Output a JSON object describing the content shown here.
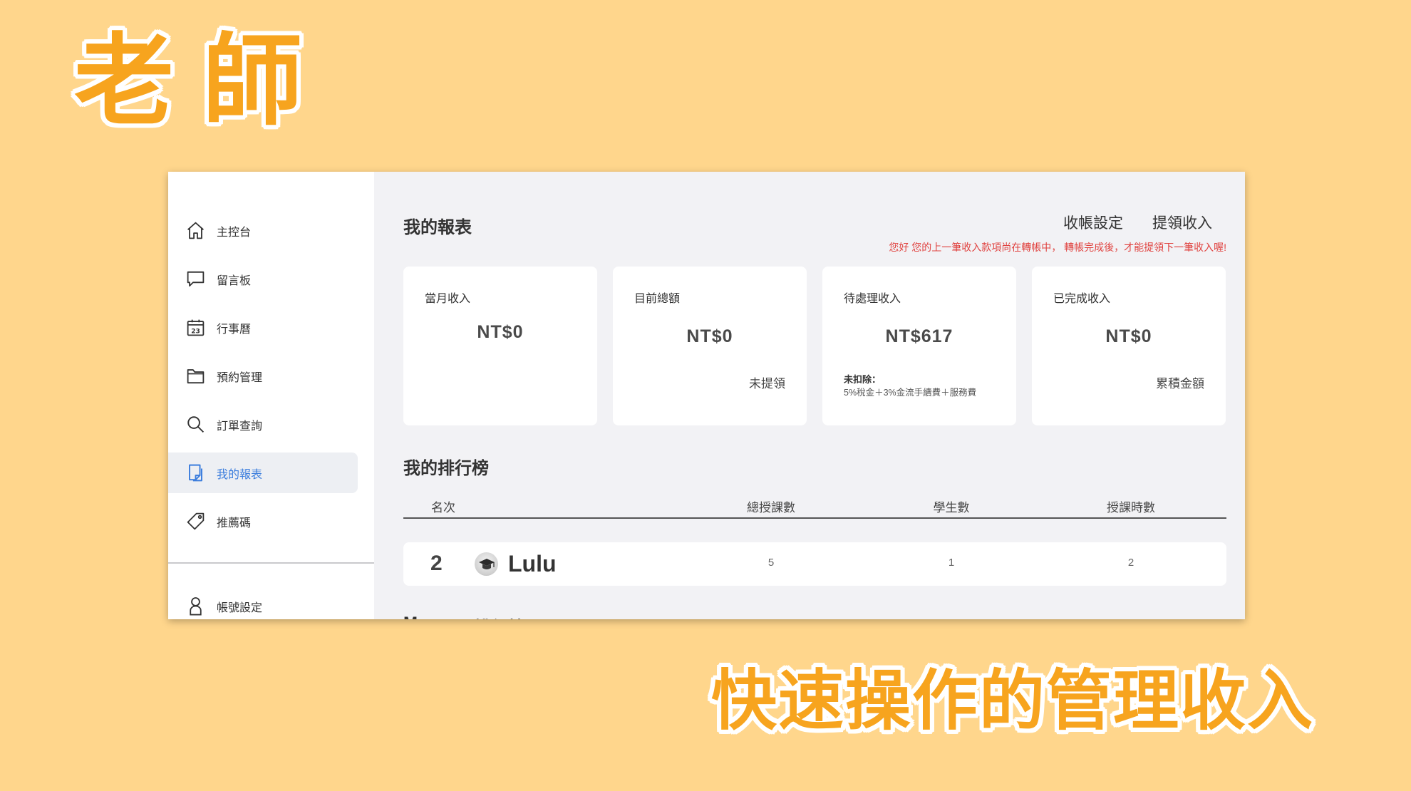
{
  "hero_title": "老師",
  "tagline": "快速操作的管理收入",
  "colors": {
    "background": "#FFD68C",
    "title_orange": "#F7A41E",
    "active_blue": "#3B7DDD",
    "notice_red": "#E0423F",
    "panel_gray": "#F2F2F5"
  },
  "sidebar": {
    "items": [
      {
        "label": "主控台",
        "icon": "home-icon"
      },
      {
        "label": "留言板",
        "icon": "message-icon"
      },
      {
        "label": "行事曆",
        "icon": "calendar-icon",
        "icon_text": "23"
      },
      {
        "label": "預約管理",
        "icon": "folder-icon"
      },
      {
        "label": "訂單查詢",
        "icon": "search-icon"
      },
      {
        "label": "我的報表",
        "icon": "report-icon",
        "active": true
      },
      {
        "label": "推薦碼",
        "icon": "tag-icon"
      }
    ],
    "footer_items": [
      {
        "label": "帳號設定",
        "icon": "user-icon"
      }
    ]
  },
  "main": {
    "title": "我的報表",
    "actions": [
      {
        "label": "收帳設定"
      },
      {
        "label": "提領收入"
      }
    ],
    "notice": "您好 您的上一筆收入款項尚在轉帳中， 轉帳完成後，才能提領下一筆收入喔!",
    "stats": [
      {
        "label": "當月收入",
        "value": "NT$0"
      },
      {
        "label": "目前總額",
        "value": "NT$0",
        "note": "未提領"
      },
      {
        "label": "待處理收入",
        "value": "NT$617",
        "note_title": "未扣除：",
        "note_detail": "5%稅金＋3%金流手續費＋服務費"
      },
      {
        "label": "已完成收入",
        "value": "NT$0",
        "note": "累積金額"
      }
    ],
    "ranking": {
      "title": "我的排行榜",
      "columns": [
        "名次",
        "總授課數",
        "學生數",
        "授課時數"
      ],
      "rows": [
        {
          "rank": "2",
          "name": "Lulu",
          "courses": "5",
          "students": "1",
          "hours": "2"
        }
      ]
    },
    "next_section_fragments": [
      "M",
      "排行榜"
    ]
  }
}
